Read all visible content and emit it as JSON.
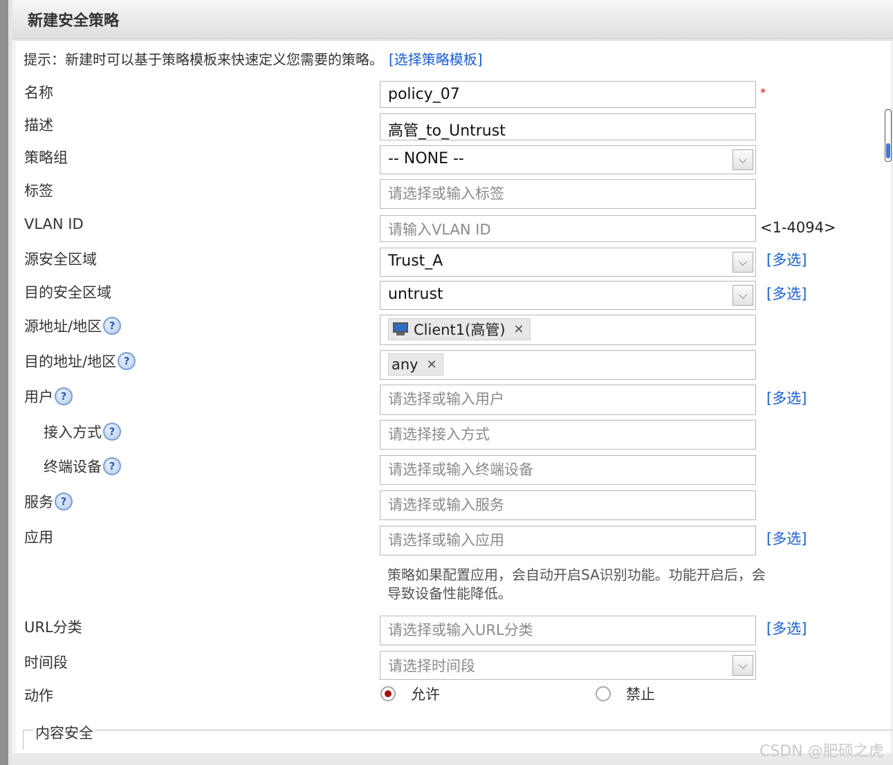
{
  "window": {
    "title": "新建安全策略"
  },
  "hint": {
    "text": "提示：新建时可以基于策略模板来快速定义您需要的策略。",
    "link": "[选择策略模板]"
  },
  "form": {
    "name": {
      "label": "名称",
      "value": "policy_07",
      "required_mark": "*"
    },
    "description": {
      "label": "描述",
      "value": "高管_to_Untrust"
    },
    "policy_group": {
      "label": "策略组",
      "value": "-- NONE --"
    },
    "tag": {
      "label": "标签",
      "placeholder": "请选择或输入标签"
    },
    "vlan": {
      "label": "VLAN ID",
      "placeholder": "请输入VLAN ID",
      "range": "<1-4094>"
    },
    "src_zone": {
      "label": "源安全区域",
      "value": "Trust_A",
      "multi": "[多选]"
    },
    "dst_zone": {
      "label": "目的安全区域",
      "value": "untrust",
      "multi": "[多选]"
    },
    "src_addr": {
      "label": "源地址/地区",
      "tag": "Client1(高管)"
    },
    "dst_addr": {
      "label": "目的地址/地区",
      "tag": "any"
    },
    "user": {
      "label": "用户",
      "placeholder": "请选择或输入用户",
      "multi": "[多选]"
    },
    "access_mode": {
      "label": "接入方式",
      "placeholder": "请选择接入方式"
    },
    "terminal": {
      "label": "终端设备",
      "placeholder": "请选择或输入终端设备"
    },
    "service": {
      "label": "服务",
      "placeholder": "请选择或输入服务"
    },
    "application": {
      "label": "应用",
      "placeholder": "请选择或输入应用",
      "multi": "[多选]",
      "note": "策略如果配置应用，会自动开启SA识别功能。功能开启后，会导致设备性能降低。"
    },
    "url_category": {
      "label": "URL分类",
      "placeholder": "请选择或输入URL分类",
      "multi": "[多选]"
    },
    "time_range": {
      "label": "时间段",
      "placeholder": "请选择时间段"
    },
    "action": {
      "label": "动作",
      "permit": "允许",
      "deny": "禁止",
      "selected": "允许"
    }
  },
  "section": {
    "content_security": "内容安全"
  },
  "help_glyph": "?",
  "dropdown_glyph": "⌵",
  "remove_glyph": "✕",
  "watermark": "CSDN @肥硕之虎",
  "colors": {
    "link": "#1a5fd0",
    "required": "#dd0000",
    "radio_checked": "#a81010"
  }
}
